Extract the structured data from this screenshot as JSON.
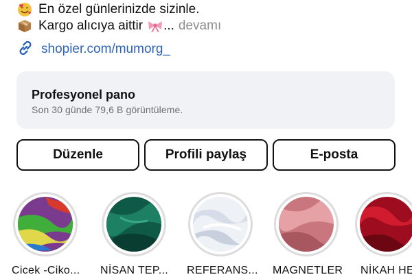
{
  "bio": {
    "line1": {
      "emoji_icon": "smiling-face-with-hearts-icon",
      "text": "En özel günlerinizde sizinle."
    },
    "line2": {
      "emoji_icon": "package-icon",
      "text": "Kargo alıcıya aittir",
      "trailing_icon": "ribbon-icon",
      "ellipsis": "...",
      "more": "devamı"
    }
  },
  "link": {
    "icon": "link-icon",
    "text": "shopier.com/mumorg_"
  },
  "dashboard": {
    "title": "Profesyonel pano",
    "subtitle": "Son 30 günde 79,6 B görüntüleme."
  },
  "actions": {
    "edit": "Düzenle",
    "share": "Profili paylaş",
    "email": "E-posta"
  },
  "highlights": [
    {
      "label": "Cicek -Ciko...",
      "colors": [
        "#7a3b8f",
        "#3fae3a",
        "#e0d84a",
        "#d9392b"
      ]
    },
    {
      "label": "NİSAN TEP...",
      "colors": [
        "#0f5a47",
        "#1e8063",
        "#0a3d31"
      ]
    },
    {
      "label": "REFERANS...",
      "colors": [
        "#f4f6fa",
        "#d7dde8",
        "#ffffff"
      ]
    },
    {
      "label": "MAGNETLER",
      "colors": [
        "#c9767f",
        "#e5a1a6",
        "#a85660"
      ]
    },
    {
      "label": "NİKAH HE",
      "colors": [
        "#9d0d1f",
        "#d01c2e",
        "#6c0613"
      ]
    }
  ],
  "colors": {
    "link": "#2c63b8",
    "card_bg": "#f0f2f5",
    "muted": "#8e8e8e",
    "highlight_ring": "#dcdcdc"
  }
}
